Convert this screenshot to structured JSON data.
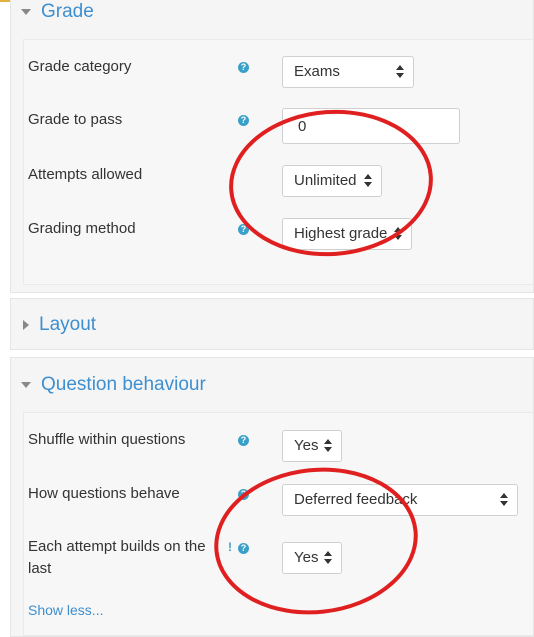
{
  "sections": {
    "grade": {
      "title": "Grade",
      "fields": {
        "grade_category": {
          "label": "Grade category",
          "value": "Exams"
        },
        "grade_to_pass": {
          "label": "Grade to pass",
          "value": "0"
        },
        "attempts_allowed": {
          "label": "Attempts allowed",
          "value": "Unlimited"
        },
        "grading_method": {
          "label": "Grading method",
          "value": "Highest grade"
        }
      }
    },
    "layout": {
      "title": "Layout"
    },
    "question_behaviour": {
      "title": "Question behaviour",
      "fields": {
        "shuffle": {
          "label": "Shuffle within questions",
          "value": "Yes"
        },
        "how_behave": {
          "label": "How questions behave",
          "value": "Deferred feedback"
        },
        "each_attempt_line1": "Each attempt builds on the",
        "each_attempt_line2": "last",
        "each_attempt_value": "Yes"
      },
      "show_less": "Show less..."
    }
  },
  "icons": {
    "help": "?",
    "warning": "!"
  },
  "colors": {
    "accent": "#3d8fd0",
    "help": "#3aa0c8",
    "annotation": "#e02020",
    "top_line": "#e3b23c"
  }
}
